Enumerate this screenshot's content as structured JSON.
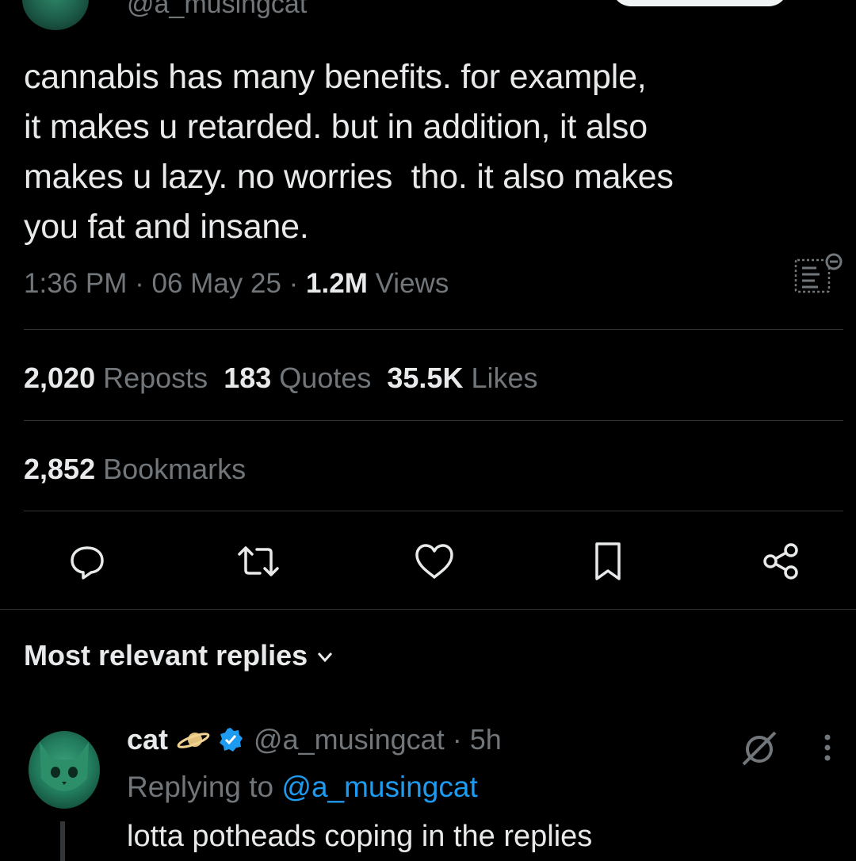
{
  "tweet": {
    "handle": "@a_musingcat",
    "text_lines": [
      "cannabis has many benefits. for example,",
      "it makes u retarded. but in addition, it also",
      "makes u lazy. no worries  tho. it also makes",
      "you fat and insane."
    ],
    "time": "1:36 PM",
    "date": "06 May 25",
    "views_count": "1.2M",
    "views_label": "Views",
    "separator": "·"
  },
  "stats": {
    "reposts_count": "2,020",
    "reposts_label": "Reposts",
    "quotes_count": "183",
    "quotes_label": "Quotes",
    "likes_count": "35.5K",
    "likes_label": "Likes",
    "bookmarks_count": "2,852",
    "bookmarks_label": "Bookmarks"
  },
  "actions": [
    "reply-icon",
    "repost-icon",
    "like-icon",
    "bookmark-icon",
    "share-icon"
  ],
  "replies_section": {
    "title": "Most relevant replies"
  },
  "reply": {
    "name": "cat",
    "handle": "@a_musingcat",
    "age": "5h",
    "replying_prefix": "Replying to",
    "replying_to": "@a_musingcat",
    "text": "lotta potheads coping in the replies"
  },
  "colors": {
    "background": "#000000",
    "text": "#e7e9ea",
    "muted": "#71767b",
    "link": "#1d9bf0",
    "divider": "#2f3336"
  }
}
